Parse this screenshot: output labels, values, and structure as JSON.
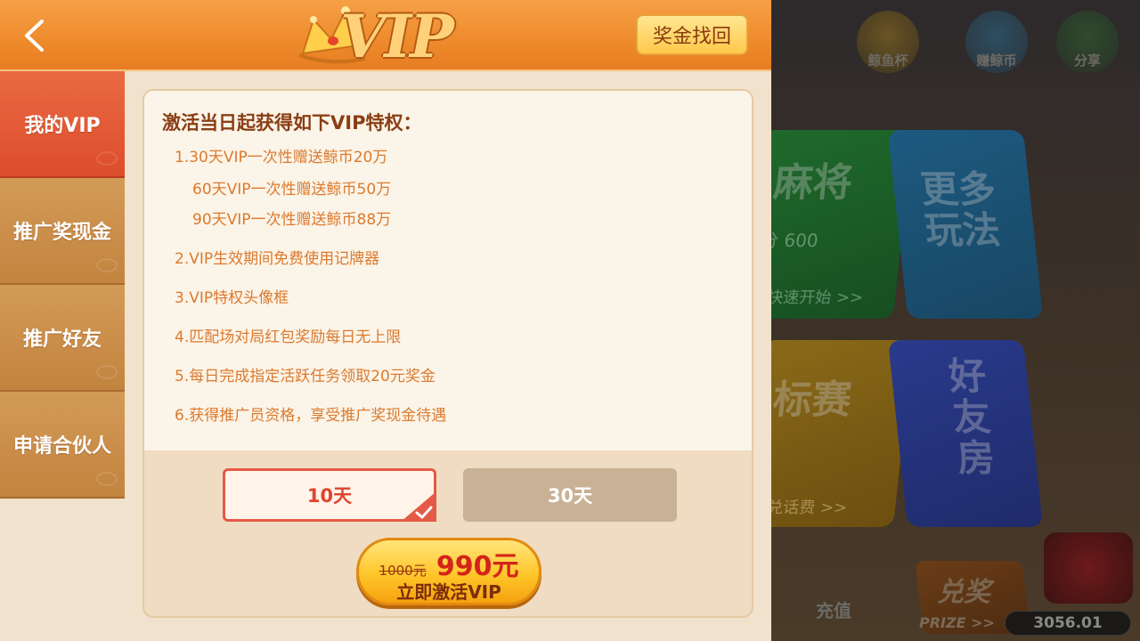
{
  "header": {
    "title": "VIP",
    "retrieve_label": "奖金找回"
  },
  "sidebar": {
    "items": [
      {
        "label": "我的VIP",
        "active": true
      },
      {
        "label": "推广奖现金",
        "active": false
      },
      {
        "label": "推广好友",
        "active": false
      },
      {
        "label": "申请合伙人",
        "active": false
      }
    ]
  },
  "perks": {
    "title": "激活当日起获得如下VIP特权：",
    "lines": [
      "1.30天VIP一次性赠送鲸币20万",
      "60天VIP一次性赠送鲸币50万",
      "90天VIP一次性赠送鲸币88万",
      "2.VIP生效期间免费使用记牌器",
      "3.VIP特权头像框",
      "4.匹配场对局红包奖励每日无上限",
      "5.每日完成指定活跃任务领取20元奖金",
      "6.获得推广员资格，享受推广奖现金待遇"
    ]
  },
  "duration": {
    "options": [
      "10天",
      "30天"
    ],
    "selected": "10天"
  },
  "activate": {
    "old_price": "1000元",
    "new_price": "990元",
    "label": "立即激活VIP"
  },
  "lobby": {
    "top_icons": [
      "鲸鱼杯",
      "赚鲸币",
      "分享"
    ],
    "mahjong_title": "麻将",
    "mahjong_sub": "分 600",
    "mahjong_quick": "快速开始 >>",
    "more_title": "更多玩法",
    "match_title": "标赛",
    "match_sub": "兑话费 >>",
    "friend_title": "好友房",
    "recharge": "充值",
    "prize_cn": "兑奖",
    "prize_en": "PRIZE >>",
    "balance": "3056.01"
  },
  "colors": {
    "header_orange": "#ee8a2c",
    "sidebar_active": "#dc4d2c",
    "sidebar_inactive": "#c2843f",
    "perk_text": "#dc7a2e",
    "price_red": "#d4231a"
  }
}
